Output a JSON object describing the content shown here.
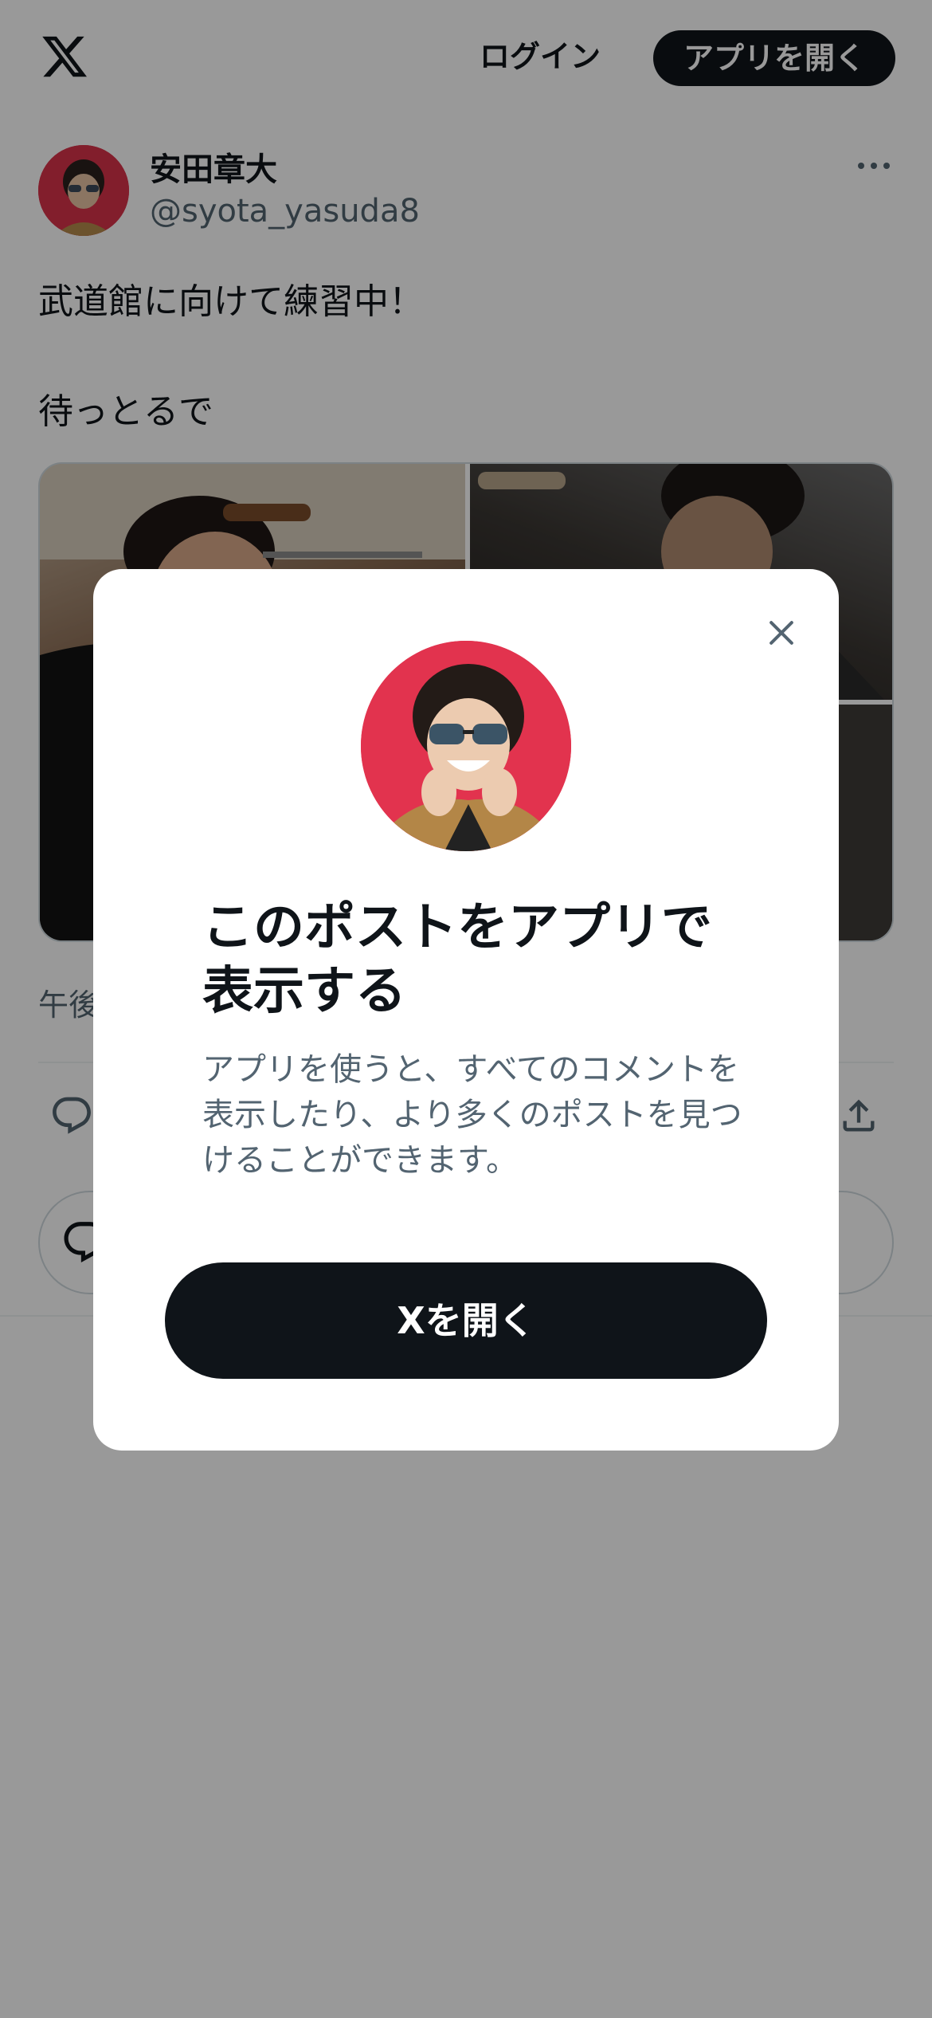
{
  "topbar": {
    "logo_icon": "x-logo-icon",
    "login_label": "ログイン",
    "open_app_label": "アプリを開く"
  },
  "post": {
    "author_name": "安田章大",
    "author_handle": "@syota_yasuda8",
    "text_line_1": "武道館に向けて練習中！",
    "text_line_2": "待っとるで",
    "timestamp": "午後",
    "media_count": 3
  },
  "modal": {
    "title": "このポストをアプリで表示する",
    "description": "アプリを使うと、すべてのコメントを表示したり、より多くのポストを見つけることができます。",
    "cta_label": "Xを開く",
    "close_icon": "close-icon"
  },
  "colors": {
    "text_primary": "#0f1419",
    "text_secondary": "#536471",
    "button_dark": "#0f1419",
    "overlay": "rgba(0,0,0,0.4)",
    "avatar_bg": "#e2334e"
  }
}
